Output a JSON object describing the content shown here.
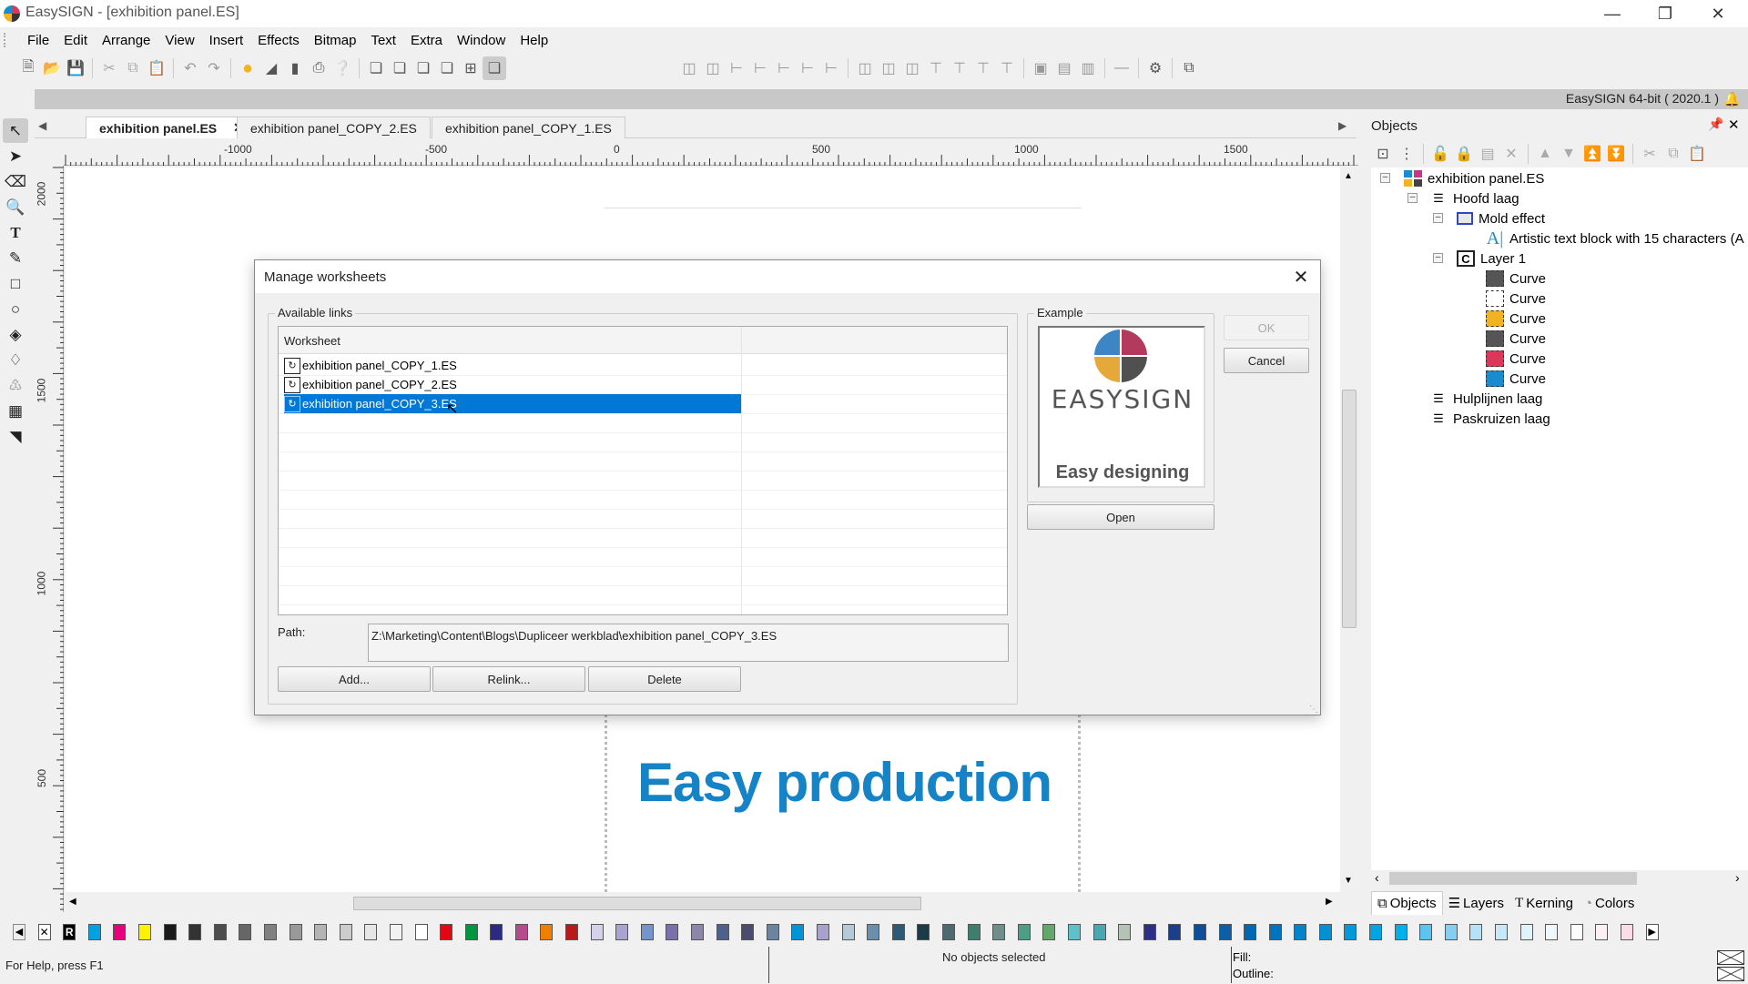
{
  "window": {
    "title": "EasySIGN - [exhibition panel.ES]",
    "version_label": "EasySIGN 64-bit ( 2020.1 )",
    "controls": [
      "minimize",
      "restore",
      "close"
    ]
  },
  "menu": [
    "File",
    "Edit",
    "Arrange",
    "View",
    "Insert",
    "Effects",
    "Bitmap",
    "Text",
    "Extra",
    "Window",
    "Help"
  ],
  "toolbar": {
    "file_icons": [
      "new-icon",
      "open-icon",
      "save-icon"
    ],
    "edit_icons": [
      "cut-icon",
      "copy-icon",
      "paste-icon"
    ],
    "history_icons": [
      "undo-icon",
      "redo-icon"
    ],
    "output_icons": [
      "fill-color-icon",
      "cutter-icon",
      "print-device-icon",
      "print-icon",
      "help-icon"
    ],
    "arrange_icons": [
      "to-front-icon",
      "forward-icon",
      "backward-icon",
      "to-back-icon",
      "group-icon",
      "view-mode-icon"
    ],
    "align_icons": [
      "align-left-icon",
      "align-center-icon",
      "align-right-icon",
      "distribute-1-icon",
      "distribute-2-icon",
      "distribute-3-icon",
      "distribute-4-icon",
      "align-top-icon",
      "align-middle-icon",
      "align-bottom-icon",
      "space-1-icon",
      "space-2-icon",
      "space-3-icon",
      "space-4-icon",
      "size-1-icon",
      "size-2-icon",
      "size-3-icon",
      "line-icon",
      "settings-icon",
      "window-icon"
    ]
  },
  "left_tools": [
    "select-tool-icon",
    "node-tool-icon",
    "eraser-tool-icon",
    "zoom-tool-icon",
    "text-tool-icon",
    "pen-tool-icon",
    "rectangle-tool-icon",
    "ellipse-tool-icon",
    "fill-tool-icon",
    "outline-tool-icon",
    "stamp-tool-icon",
    "table-tool-icon",
    "page-tool-icon"
  ],
  "tabs": [
    {
      "label": "exhibition panel.ES",
      "active": true,
      "closable": true
    },
    {
      "label": "exhibition panel_COPY_2.ES",
      "active": false
    },
    {
      "label": "exhibition panel_COPY_1.ES",
      "active": false
    }
  ],
  "rulers": {
    "horizontal_labels": [
      "-1000",
      "-500",
      "0",
      "500",
      "1000",
      "1500"
    ],
    "vertical_labels": [
      "2000",
      "1500",
      "1000",
      "500"
    ]
  },
  "canvas": {
    "text": "Easy production",
    "text_color": "#1583c5"
  },
  "objects_panel": {
    "title": "Objects",
    "tree": [
      {
        "label": "exhibition panel.ES",
        "icon": "document-icon",
        "level": 0,
        "expanded": true
      },
      {
        "label": "Hoofd laag",
        "icon": "layer-icon",
        "level": 1,
        "expanded": true
      },
      {
        "label": "Mold effect",
        "icon": "mold-effect-icon",
        "level": 2,
        "expanded": true
      },
      {
        "label": "Artistic text block with 15 characters (A",
        "icon": "text-icon",
        "level": 3
      },
      {
        "label": "Layer 1",
        "icon": "group-icon",
        "level": 2,
        "expanded": true
      },
      {
        "label": "Curve",
        "icon": "curve-icon",
        "level": 3,
        "color": "#555555"
      },
      {
        "label": "Curve",
        "icon": "curve-icon",
        "level": 3,
        "color": "#ffffff"
      },
      {
        "label": "Curve",
        "icon": "curve-icon",
        "level": 3,
        "color": "#f0b323"
      },
      {
        "label": "Curve",
        "icon": "curve-icon",
        "level": 3,
        "color": "#555555"
      },
      {
        "label": "Curve",
        "icon": "curve-icon",
        "level": 3,
        "color": "#d9385a"
      },
      {
        "label": "Curve",
        "icon": "curve-icon",
        "level": 3,
        "color": "#1b8bcf"
      },
      {
        "label": "Hulplijnen laag",
        "icon": "layer-icon",
        "level": 1
      },
      {
        "label": "Paskruizen laag",
        "icon": "layer-icon",
        "level": 1
      }
    ],
    "bottom_tabs": [
      "Objects",
      "Layers",
      "Kerning",
      "Colors"
    ]
  },
  "palette": [
    "#00a0e3",
    "#e5007d",
    "#fff200",
    "#1a1a1a",
    "#333333",
    "#4d4d4d",
    "#666666",
    "#808080",
    "#999999",
    "#b3b3b3",
    "#cccccc",
    "#e6e6e6",
    "#f2f2f2",
    "#ffffff",
    "#e30613",
    "#009640",
    "#2b2a84",
    "#b54a8c",
    "#f07f00",
    "#b81a1a",
    "#d4d0e8",
    "#a9a3cf",
    "#7494cb",
    "#7a70aa",
    "#8b86aa",
    "#4d618a",
    "#4b4c6e",
    "#6b85a0",
    "#0094d9",
    "#a8a1cb",
    "#b5c9d8",
    "#6b8eaa",
    "#2e5a73",
    "#1a3b47",
    "#50696e",
    "#3e7e6e",
    "#6f8d8b",
    "#4e9d86",
    "#62a76b",
    "#5ec1ca",
    "#4aa6b0",
    "#b5c3b4",
    "#2e2f87",
    "#1c3f8c",
    "#0b4f9b",
    "#0a5fa7",
    "#0068b2",
    "#0074bf",
    "#0085cb",
    "#0092d4",
    "#0099db",
    "#00a4e3",
    "#00b0eb",
    "#5bc4f1",
    "#84cfef",
    "#b6e1f6",
    "#c9e8f7",
    "#dff3fb",
    "#eef7fc",
    "#fbfbfb",
    "#fdf0f5",
    "#f9dce6"
  ],
  "status": {
    "help": "For Help, press F1",
    "selection": "No objects selected",
    "fill_label": "Fill:",
    "outline_label": "Outline:"
  },
  "dialog": {
    "title": "Manage worksheets",
    "available_links_label": "Available links",
    "column_header": "Worksheet",
    "rows": [
      {
        "label": "exhibition panel_COPY_1.ES",
        "selected": false
      },
      {
        "label": "exhibition panel_COPY_2.ES",
        "selected": false
      },
      {
        "label": "exhibition panel_COPY_3.ES",
        "selected": true
      }
    ],
    "path_label": "Path:",
    "path_value": "Z:\\Marketing\\Content\\Blogs\\Dupliceer werkblad\\exhibition panel_COPY_3.ES",
    "example_label": "Example",
    "example_brand": "EASYSIGN",
    "example_caption": "Easy designing",
    "buttons": {
      "add": "Add...",
      "relink": "Relink...",
      "delete": "Delete",
      "open": "Open",
      "ok": "OK",
      "cancel": "Cancel"
    }
  }
}
